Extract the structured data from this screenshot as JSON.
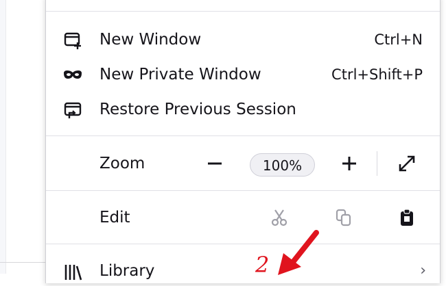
{
  "menu": {
    "new_window": {
      "label": "New Window",
      "shortcut": "Ctrl+N",
      "icon": "new-window-icon"
    },
    "new_private_window": {
      "label": "New Private Window",
      "shortcut": "Ctrl+Shift+P",
      "icon": "private-mask-icon"
    },
    "restore_session": {
      "label": "Restore Previous Session",
      "icon": "restore-session-icon"
    },
    "zoom": {
      "label": "Zoom",
      "value": "100%",
      "decrease_icon": "minus-icon",
      "increase_icon": "plus-icon",
      "fullscreen_icon": "fullscreen-icon"
    },
    "edit": {
      "label": "Edit",
      "cut_icon": "scissors-icon",
      "copy_icon": "copy-icon",
      "paste_icon": "clipboard-icon"
    },
    "library": {
      "label": "Library",
      "icon": "library-icon",
      "chevron": "›"
    }
  },
  "annotation": {
    "number": "2",
    "color": "#e0141e"
  }
}
